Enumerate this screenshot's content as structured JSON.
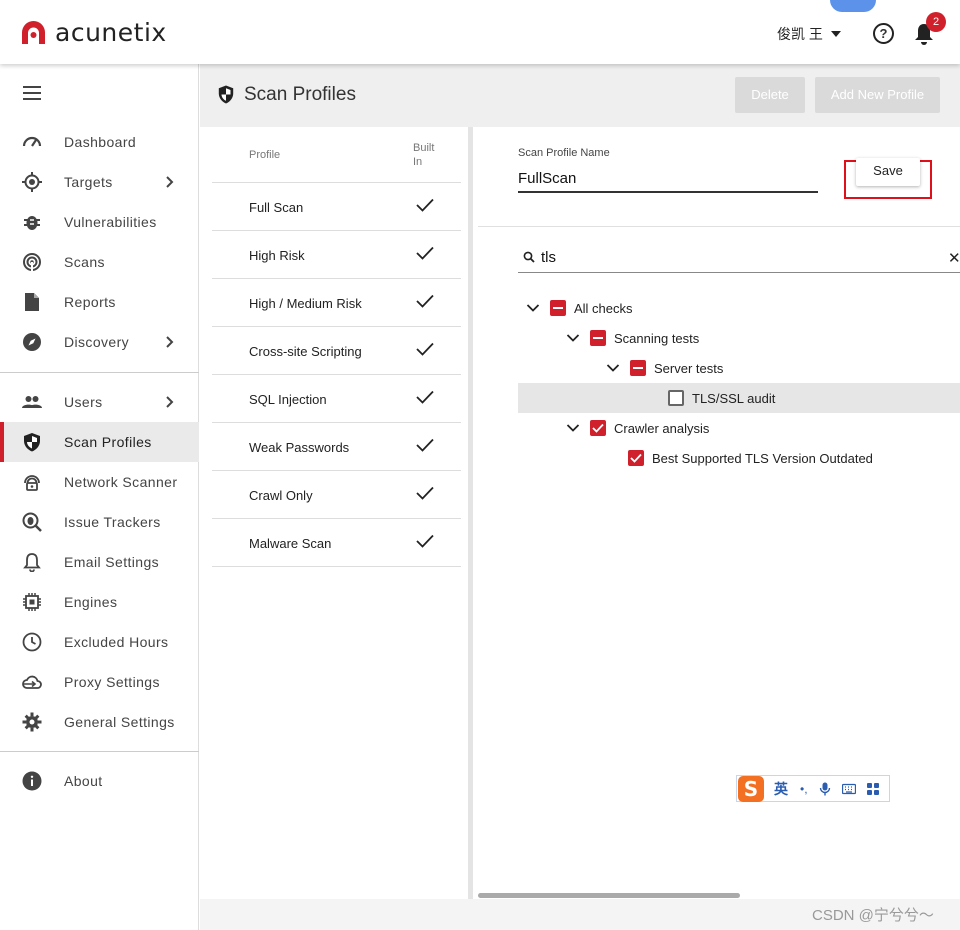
{
  "app": {
    "logo_text": "acunetix",
    "brand_color": "#d0202c"
  },
  "topbar": {
    "user_name": "俊凯 王",
    "notification_count": "2"
  },
  "sidebar": {
    "items": [
      {
        "label": "Dashboard",
        "icon": "gauge-icon"
      },
      {
        "label": "Targets",
        "icon": "target-icon"
      },
      {
        "label": "Vulnerabilities",
        "icon": "bug-icon"
      },
      {
        "label": "Scans",
        "icon": "radar-icon"
      },
      {
        "label": "Reports",
        "icon": "document-icon"
      },
      {
        "label": "Discovery",
        "icon": "compass-icon"
      },
      {
        "label": "Users",
        "icon": "users-icon"
      },
      {
        "label": "Scan Profiles",
        "icon": "shield-icon"
      },
      {
        "label": "Network Scanner",
        "icon": "network-scanner-icon"
      },
      {
        "label": "Issue Trackers",
        "icon": "issue-tracker-icon"
      },
      {
        "label": "Email Settings",
        "icon": "bell-icon"
      },
      {
        "label": "Engines",
        "icon": "chip-icon"
      },
      {
        "label": "Excluded Hours",
        "icon": "clock-icon"
      },
      {
        "label": "Proxy Settings",
        "icon": "cloud-icon"
      },
      {
        "label": "General Settings",
        "icon": "gear-icon"
      },
      {
        "label": "About",
        "icon": "info-icon"
      }
    ]
  },
  "header": {
    "title": "Scan Profiles",
    "delete_label": "Delete",
    "add_label": "Add New Profile"
  },
  "profiles": {
    "col_profile": "Profile",
    "col_builtin": "Built In",
    "rows": [
      {
        "name": "Full Scan",
        "builtin": true
      },
      {
        "name": "High Risk",
        "builtin": true
      },
      {
        "name": "High / Medium Risk",
        "builtin": true
      },
      {
        "name": "Cross-site Scripting",
        "builtin": true
      },
      {
        "name": "SQL Injection",
        "builtin": true
      },
      {
        "name": "Weak Passwords",
        "builtin": true
      },
      {
        "name": "Crawl Only",
        "builtin": true
      },
      {
        "name": "Malware Scan",
        "builtin": true
      }
    ]
  },
  "detail": {
    "name_label": "Scan Profile Name",
    "name_value": "FullScan",
    "save_label": "Save",
    "search_value": "tls",
    "tree": {
      "all_checks": "All checks",
      "scanning_tests": "Scanning tests",
      "server_tests": "Server tests",
      "tls_audit": "TLS/SSL audit",
      "crawler_analysis": "Crawler analysis",
      "best_tls": "Best Supported TLS Version Outdated"
    }
  },
  "ime": {
    "mode": "英",
    "punct": "•,"
  },
  "watermark": "CSDN @宁兮兮～"
}
